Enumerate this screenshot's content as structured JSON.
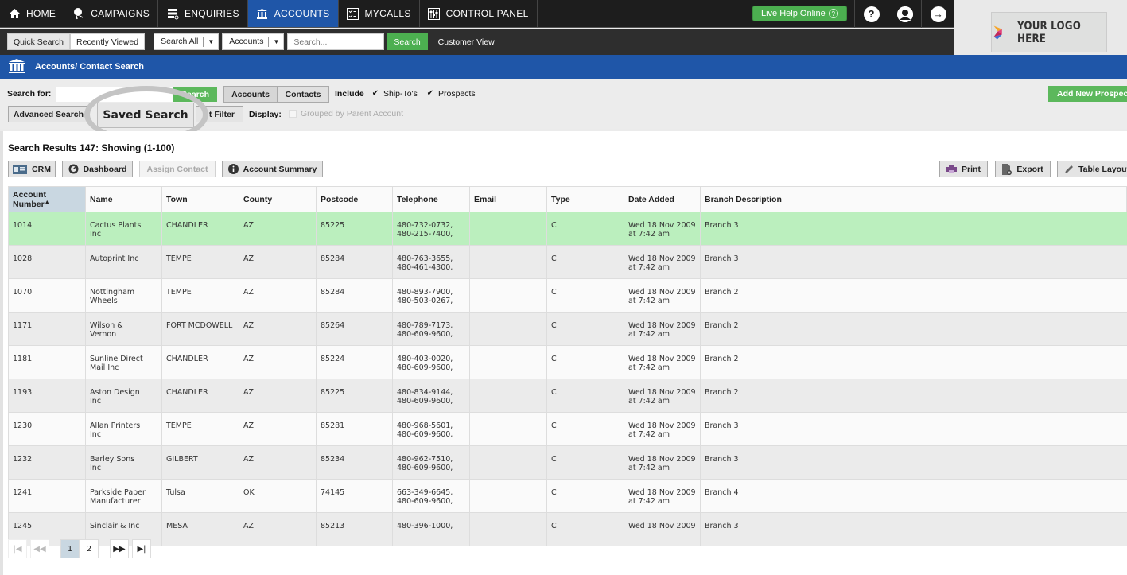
{
  "nav": {
    "items": [
      {
        "label": "HOME",
        "icon": "home-icon"
      },
      {
        "label": "CAMPAIGNS",
        "icon": "campaigns-icon"
      },
      {
        "label": "ENQUIRIES",
        "icon": "enquiries-icon"
      },
      {
        "label": "ACCOUNTS",
        "icon": "bank-icon",
        "active": true
      },
      {
        "label": "MYCALLS",
        "icon": "checklist-icon"
      },
      {
        "label": "CONTROL PANEL",
        "icon": "control-panel-icon"
      }
    ],
    "live_help": "Live Help Online",
    "help_symbol": "?",
    "logout_symbol": "→"
  },
  "logo": {
    "text": "YOUR LOGO HERE"
  },
  "subbar": {
    "quick_search": "Quick Search",
    "recently_viewed": "Recently Viewed",
    "scope_select": "Search All",
    "type_select": "Accounts",
    "search_placeholder": "Search...",
    "search_button": "Search",
    "customer_view": "Customer View"
  },
  "page": {
    "title": "Accounts/ Contact Search"
  },
  "filters": {
    "search_for_label": "Search for:",
    "search_for_value": "",
    "search_button": "Search",
    "accounts_toggle": "Accounts",
    "contacts_toggle": "Contacts",
    "include_label": "Include",
    "ship_tos": {
      "label": "Ship-To's",
      "checked": true
    },
    "prospects": {
      "label": "Prospects",
      "checked": true
    },
    "advanced_search": "Advanced Search",
    "saved_search": "Saved Search",
    "filter_button": "Set Filter",
    "filter_visible": "t Filter",
    "display_label": "Display:",
    "grouped": {
      "label": "Grouped by Parent Account",
      "checked": false
    },
    "add_new_prospect": "Add New Prospect"
  },
  "results": {
    "title": "Search Results 147: Showing (1-100)",
    "actions": {
      "crm": "CRM",
      "dashboard": "Dashboard",
      "assign_contact": "Assign Contact",
      "account_summary": "Account Summary",
      "print": "Print",
      "export": "Export",
      "table_layout": "Table Layout"
    },
    "columns": [
      "Account Number",
      "Name",
      "Town",
      "County",
      "Postcode",
      "Telephone",
      "Email",
      "Type",
      "Date Added",
      "Branch Description"
    ],
    "sorted_column": "Account Number",
    "rows": [
      {
        "account": "1014",
        "name": "Cactus Plants Inc",
        "town": "CHANDLER",
        "county": "AZ",
        "postcode": "85225",
        "tel1": "480-732-0732,",
        "tel2": "480-215-7400,",
        "email": "",
        "type": "C",
        "date1": "Wed 18 Nov 2009",
        "date2": "at 7:42 am",
        "branch": "Branch 3",
        "selected": true
      },
      {
        "account": "1028",
        "name": "Autoprint Inc",
        "town": "TEMPE",
        "county": "AZ",
        "postcode": "85284",
        "tel1": "480-763-3655,",
        "tel2": "480-461-4300,",
        "email": "",
        "type": "C",
        "date1": "Wed 18 Nov 2009",
        "date2": "at 7:42 am",
        "branch": "Branch 3"
      },
      {
        "account": "1070",
        "name": "Nottingham Wheels",
        "town": "TEMPE",
        "county": "AZ",
        "postcode": "85284",
        "tel1": "480-893-7900,",
        "tel2": "480-503-0267,",
        "email": "",
        "type": "C",
        "date1": "Wed 18 Nov 2009",
        "date2": "at 7:42 am",
        "branch": "Branch 2"
      },
      {
        "account": "1171",
        "name": "Wilson & Vernon",
        "town": "FORT MCDOWELL",
        "county": "AZ",
        "postcode": "85264",
        "tel1": "480-789-7173,",
        "tel2": "480-609-9600,",
        "email": "",
        "type": "C",
        "date1": "Wed 18 Nov 2009",
        "date2": "at 7:42 am",
        "branch": "Branch 2"
      },
      {
        "account": "1181",
        "name": "Sunline Direct Mail Inc",
        "town": "CHANDLER",
        "county": "AZ",
        "postcode": "85224",
        "tel1": "480-403-0020,",
        "tel2": "480-609-9600,",
        "email": "",
        "type": "C",
        "date1": "Wed 18 Nov 2009",
        "date2": "at 7:42 am",
        "branch": "Branch 2"
      },
      {
        "account": "1193",
        "name": "Aston Design Inc",
        "town": "CHANDLER",
        "county": "AZ",
        "postcode": "85225",
        "tel1": "480-834-9144,",
        "tel2": "480-609-9600,",
        "email": "",
        "type": "C",
        "date1": "Wed 18 Nov 2009",
        "date2": "at 7:42 am",
        "branch": "Branch 2"
      },
      {
        "account": "1230",
        "name": "Allan Printers Inc",
        "town": "TEMPE",
        "county": "AZ",
        "postcode": "85281",
        "tel1": "480-968-5601,",
        "tel2": "480-609-9600,",
        "email": "",
        "type": "C",
        "date1": "Wed 18 Nov 2009",
        "date2": "at 7:42 am",
        "branch": "Branch 3"
      },
      {
        "account": "1232",
        "name": "Barley Sons Inc",
        "town": "GILBERT",
        "county": "AZ",
        "postcode": "85234",
        "tel1": "480-962-7510,",
        "tel2": "480-609-9600,",
        "email": "",
        "type": "C",
        "date1": "Wed 18 Nov 2009",
        "date2": "at 7:42 am",
        "branch": "Branch 3"
      },
      {
        "account": "1241",
        "name": "Parkside Paper Manufacturer",
        "town": "Tulsa",
        "county": "OK",
        "postcode": "74145",
        "tel1": "663-349-6645,",
        "tel2": "480-609-9600,",
        "email": "",
        "type": "C",
        "date1": "Wed 18 Nov 2009",
        "date2": "at 7:42 am",
        "branch": "Branch 4"
      },
      {
        "account": "1245",
        "name": "Sinclair & Inc",
        "town": "MESA",
        "county": "AZ",
        "postcode": "85213",
        "tel1": "480-396-1000,",
        "tel2": "",
        "email": "",
        "type": "C",
        "date1": "Wed 18 Nov 2009",
        "date2": "",
        "branch": "Branch 3"
      }
    ]
  },
  "pagination": {
    "first": "⏮",
    "prev": "◀◀",
    "pages": [
      "1",
      "2"
    ],
    "current_page": "1",
    "next": "▶▶",
    "last": "⏭"
  },
  "colors": {
    "accent_blue": "#1f56a8",
    "green": "#5cb85c",
    "selected_row": "#bbefbe",
    "topbar": "#1d1d1d"
  }
}
